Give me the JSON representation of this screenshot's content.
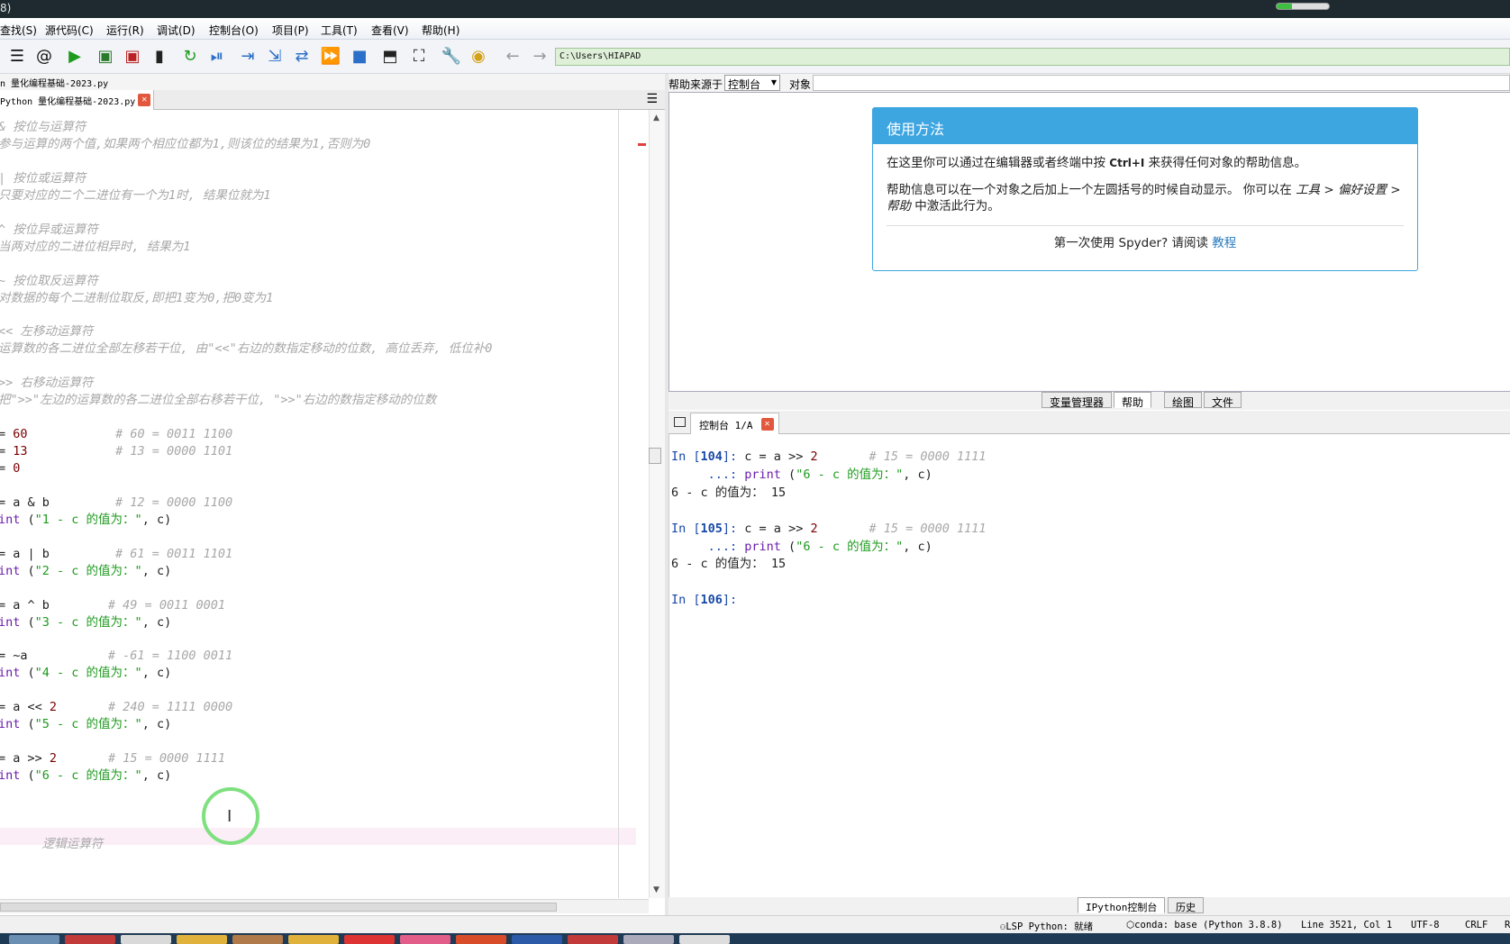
{
  "window": {
    "title_fragment": "8)"
  },
  "menubar": [
    {
      "label": "查找(S)"
    },
    {
      "label": "源代码(C)"
    },
    {
      "label": "运行(R)"
    },
    {
      "label": "调试(D)"
    },
    {
      "label": "控制台(O)"
    },
    {
      "label": "项目(P)"
    },
    {
      "label": "工具(T)"
    },
    {
      "label": "查看(V)"
    },
    {
      "label": "帮助(H)"
    }
  ],
  "toolbar": {
    "icons": [
      "list-icon",
      "at-icon",
      "run-icon",
      "run-cell-icon",
      "run-cell-advance-icon",
      "run-selection-icon",
      "rerun-icon",
      "debug-icon",
      "step-icon",
      "step-into-icon",
      "step-return-icon",
      "continue-icon",
      "stop-icon",
      "maximize-pane-icon",
      "fullscreen-icon",
      "wrench-icon",
      "python-icon",
      "back-arrow-icon",
      "forward-arrow-icon"
    ],
    "path": "C:\\Users\\HIAPAD"
  },
  "editor": {
    "file_path": "n 量化编程基础-2023.py",
    "tab_label": "Python 量化编程基础-2023.py",
    "lines": [
      {
        "parts": [
          {
            "t": "& 按位与运算符",
            "c": "cmt"
          }
        ]
      },
      {
        "parts": [
          {
            "t": "参与运算的两个值,如果两个相应位都为1,则该位的结果为1,否则为0",
            "c": "cmt"
          }
        ]
      },
      {
        "parts": [
          {
            "t": "",
            "c": "plain"
          }
        ]
      },
      {
        "parts": [
          {
            "t": "| 按位或运算符",
            "c": "cmt"
          }
        ]
      },
      {
        "parts": [
          {
            "t": "只要对应的二个二进位有一个为1时, 结果位就为1",
            "c": "cmt"
          }
        ]
      },
      {
        "parts": [
          {
            "t": "",
            "c": "plain"
          }
        ]
      },
      {
        "parts": [
          {
            "t": "^ 按位异或运算符",
            "c": "cmt"
          }
        ]
      },
      {
        "parts": [
          {
            "t": "当两对应的二进位相异时, 结果为1",
            "c": "cmt"
          }
        ]
      },
      {
        "parts": [
          {
            "t": "",
            "c": "plain"
          }
        ]
      },
      {
        "parts": [
          {
            "t": "~ 按位取反运算符",
            "c": "cmt"
          }
        ]
      },
      {
        "parts": [
          {
            "t": "对数据的每个二进制位取反,即把1变为0,把0变为1",
            "c": "cmt"
          }
        ]
      },
      {
        "parts": [
          {
            "t": "",
            "c": "plain"
          }
        ]
      },
      {
        "parts": [
          {
            "t": "<< 左移动运算符",
            "c": "cmt"
          }
        ]
      },
      {
        "parts": [
          {
            "t": "运算数的各二进位全部左移若干位, 由\"<<\"右边的数指定移动的位数, 高位丢弃, 低位补0",
            "c": "cmt"
          }
        ]
      },
      {
        "parts": [
          {
            "t": "",
            "c": "plain"
          }
        ]
      },
      {
        "parts": [
          {
            "t": ">> 右移动运算符",
            "c": "cmt"
          }
        ]
      },
      {
        "parts": [
          {
            "t": "把\">>\"左边的运算数的各二进位全部右移若干位, \">>\"右边的数指定移动的位数",
            "c": "cmt"
          }
        ]
      },
      {
        "parts": [
          {
            "t": "",
            "c": "plain"
          }
        ]
      },
      {
        "parts": [
          {
            "t": "= ",
            "c": "plain"
          },
          {
            "t": "60",
            "c": "num"
          },
          {
            "t": "            ",
            "c": "plain"
          },
          {
            "t": "# 60 = 0011 1100",
            "c": "cmt"
          }
        ]
      },
      {
        "parts": [
          {
            "t": "= ",
            "c": "plain"
          },
          {
            "t": "13",
            "c": "num"
          },
          {
            "t": "            ",
            "c": "plain"
          },
          {
            "t": "# 13 = 0000 1101",
            "c": "cmt"
          }
        ]
      },
      {
        "parts": [
          {
            "t": "= ",
            "c": "plain"
          },
          {
            "t": "0",
            "c": "num"
          }
        ]
      },
      {
        "parts": [
          {
            "t": "",
            "c": "plain"
          }
        ]
      },
      {
        "parts": [
          {
            "t": "= a & b         ",
            "c": "plain"
          },
          {
            "t": "# 12 = 0000 1100",
            "c": "cmt"
          }
        ]
      },
      {
        "parts": [
          {
            "t": "int",
            "c": "kw"
          },
          {
            "t": " (",
            "c": "plain"
          },
          {
            "t": "\"1 - c 的值为：\"",
            "c": "str"
          },
          {
            "t": ", c)",
            "c": "plain"
          }
        ]
      },
      {
        "parts": [
          {
            "t": "",
            "c": "plain"
          }
        ]
      },
      {
        "parts": [
          {
            "t": "= a | b         ",
            "c": "plain"
          },
          {
            "t": "# 61 = 0011 1101",
            "c": "cmt"
          }
        ]
      },
      {
        "parts": [
          {
            "t": "int",
            "c": "kw"
          },
          {
            "t": " (",
            "c": "plain"
          },
          {
            "t": "\"2 - c 的值为：\"",
            "c": "str"
          },
          {
            "t": ", c)",
            "c": "plain"
          }
        ]
      },
      {
        "parts": [
          {
            "t": "",
            "c": "plain"
          }
        ]
      },
      {
        "parts": [
          {
            "t": "= a ^ b        ",
            "c": "plain"
          },
          {
            "t": "# 49 = 0011 0001",
            "c": "cmt"
          }
        ]
      },
      {
        "parts": [
          {
            "t": "int",
            "c": "kw"
          },
          {
            "t": " (",
            "c": "plain"
          },
          {
            "t": "\"3 - c 的值为：\"",
            "c": "str"
          },
          {
            "t": ", c)",
            "c": "plain"
          }
        ]
      },
      {
        "parts": [
          {
            "t": "",
            "c": "plain"
          }
        ]
      },
      {
        "parts": [
          {
            "t": "= ~a           ",
            "c": "plain"
          },
          {
            "t": "# -61 = 1100 0011",
            "c": "cmt"
          }
        ]
      },
      {
        "parts": [
          {
            "t": "int",
            "c": "kw"
          },
          {
            "t": " (",
            "c": "plain"
          },
          {
            "t": "\"4 - c 的值为：\"",
            "c": "str"
          },
          {
            "t": ", c)",
            "c": "plain"
          }
        ]
      },
      {
        "parts": [
          {
            "t": "",
            "c": "plain"
          }
        ]
      },
      {
        "parts": [
          {
            "t": "= a << ",
            "c": "plain"
          },
          {
            "t": "2",
            "c": "num"
          },
          {
            "t": "       ",
            "c": "plain"
          },
          {
            "t": "# 240 = 1111 0000",
            "c": "cmt"
          }
        ]
      },
      {
        "parts": [
          {
            "t": "int",
            "c": "kw"
          },
          {
            "t": " (",
            "c": "plain"
          },
          {
            "t": "\"5 - c 的值为：\"",
            "c": "str"
          },
          {
            "t": ", c)",
            "c": "plain"
          }
        ]
      },
      {
        "parts": [
          {
            "t": "",
            "c": "plain"
          }
        ]
      },
      {
        "parts": [
          {
            "t": "= a >> ",
            "c": "plain"
          },
          {
            "t": "2",
            "c": "num"
          },
          {
            "t": "       ",
            "c": "plain"
          },
          {
            "t": "# 15 = 0000 1111",
            "c": "cmt"
          }
        ]
      },
      {
        "parts": [
          {
            "t": "int",
            "c": "kw"
          },
          {
            "t": " (",
            "c": "plain"
          },
          {
            "t": "\"6 - c 的值为：\"",
            "c": "str"
          },
          {
            "t": ", c)",
            "c": "plain"
          }
        ]
      },
      {
        "parts": [
          {
            "t": "",
            "c": "plain"
          }
        ]
      },
      {
        "parts": [
          {
            "t": "",
            "c": "plain"
          }
        ]
      },
      {
        "parts": [
          {
            "t": "",
            "c": "plain"
          }
        ]
      },
      {
        "parts": [
          {
            "t": "      逻辑运算符",
            "c": "cmt"
          }
        ]
      }
    ]
  },
  "help": {
    "source_label": "帮助来源于",
    "source_value": "控制台",
    "object_label": "对象",
    "card_title": "使用方法",
    "p1_a": "在这里你可以通过在编辑器或者终端中按 ",
    "p1_key": "Ctrl+I",
    "p1_b": " 来获得任何对象的帮助信息。",
    "p2_a": "帮助信息可以在一个对象之后加上一个左圆括号的时候自动显示。 你可以在 ",
    "p2_em": "工具 > 偏好设置 > 帮助",
    "p2_b": " 中激活此行为。",
    "p3_a": "第一次使用 Spyder? 请阅读 ",
    "p3_link": "教程"
  },
  "pane_tabs": [
    {
      "label": "变量管理器",
      "active": false
    },
    {
      "label": "帮助",
      "active": true
    },
    {
      "label": "绘图",
      "active": false
    },
    {
      "label": "文件",
      "active": false
    }
  ],
  "console": {
    "tab_label": "控制台 1/A",
    "lines": [
      {
        "parts": [
          {
            "t": "In [",
            "c": "inp"
          },
          {
            "t": "104",
            "c": "inpb"
          },
          {
            "t": "]: ",
            "c": "inp"
          },
          {
            "t": "c = a >> ",
            "c": "plain"
          },
          {
            "t": "2",
            "c": "num"
          },
          {
            "t": "       ",
            "c": "plain"
          },
          {
            "t": "# 15 = 0000 1111",
            "c": "cmt"
          }
        ]
      },
      {
        "parts": [
          {
            "t": "     ...: ",
            "c": "prm"
          },
          {
            "t": "print",
            "c": "kw"
          },
          {
            "t": " (",
            "c": "plain"
          },
          {
            "t": "\"6 - c 的值为：\"",
            "c": "str"
          },
          {
            "t": ", c)",
            "c": "plain"
          }
        ]
      },
      {
        "parts": [
          {
            "t": "6 - c 的值为： 15",
            "c": "plain"
          }
        ]
      },
      {
        "parts": [
          {
            "t": "",
            "c": "plain"
          }
        ]
      },
      {
        "parts": [
          {
            "t": "In [",
            "c": "inp"
          },
          {
            "t": "105",
            "c": "inpb"
          },
          {
            "t": "]: ",
            "c": "inp"
          },
          {
            "t": "c = a >> ",
            "c": "plain"
          },
          {
            "t": "2",
            "c": "num"
          },
          {
            "t": "       ",
            "c": "plain"
          },
          {
            "t": "# 15 = 0000 1111",
            "c": "cmt"
          }
        ]
      },
      {
        "parts": [
          {
            "t": "     ...: ",
            "c": "prm"
          },
          {
            "t": "print",
            "c": "kw"
          },
          {
            "t": " (",
            "c": "plain"
          },
          {
            "t": "\"6 - c 的值为：\"",
            "c": "str"
          },
          {
            "t": ", c)",
            "c": "plain"
          }
        ]
      },
      {
        "parts": [
          {
            "t": "6 - c 的值为： 15",
            "c": "plain"
          }
        ]
      },
      {
        "parts": [
          {
            "t": "",
            "c": "plain"
          }
        ]
      },
      {
        "parts": [
          {
            "t": "In [",
            "c": "inp"
          },
          {
            "t": "106",
            "c": "inpb"
          },
          {
            "t": "]:",
            "c": "inp"
          }
        ]
      }
    ]
  },
  "bottom_tabs": [
    {
      "label": "IPython控制台",
      "active": true
    },
    {
      "label": "历史",
      "active": false
    }
  ],
  "status": {
    "lsp": "LSP Python: 就绪",
    "conda": "conda: base (Python 3.8.8)",
    "position": "Line 3521, Col 1",
    "encoding": "UTF-8",
    "eol": "CRLF",
    "extra": "R"
  }
}
